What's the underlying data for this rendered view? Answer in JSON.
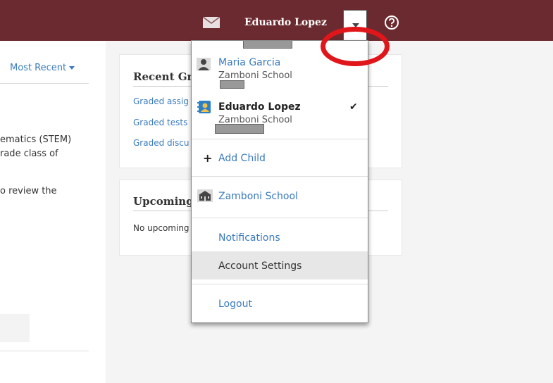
{
  "header": {
    "user_name": "Eduardo Lopez",
    "icons": [
      "envelope-icon",
      "caret-down-icon",
      "help-circle-icon"
    ]
  },
  "left": {
    "sort_label": "Most Recent",
    "lines": [
      "ematics (STEM)",
      "rade class of",
      "o review the"
    ]
  },
  "cards": {
    "recent": {
      "title": "Recent Gr",
      "links": [
        "Graded assig",
        "Graded tests",
        "Graded discu"
      ]
    },
    "upcoming": {
      "title": "Upcoming",
      "empty_text": "No upcoming"
    }
  },
  "dropdown": {
    "children": [
      {
        "name": "Maria Garcia",
        "school": "Zamboni School",
        "selected": false
      },
      {
        "name": "Eduardo Lopez",
        "school": "Zamboni School",
        "selected": true
      }
    ],
    "add_child": "Add Child",
    "school": "Zamboni School",
    "notifications": "Notifications",
    "account_settings": "Account Settings",
    "logout": "Logout",
    "check_mark": "✔",
    "plus": "+"
  },
  "colors": {
    "header_bg": "#6b2a2f",
    "link": "#3b7bbd",
    "annotation": "#e0161a"
  }
}
